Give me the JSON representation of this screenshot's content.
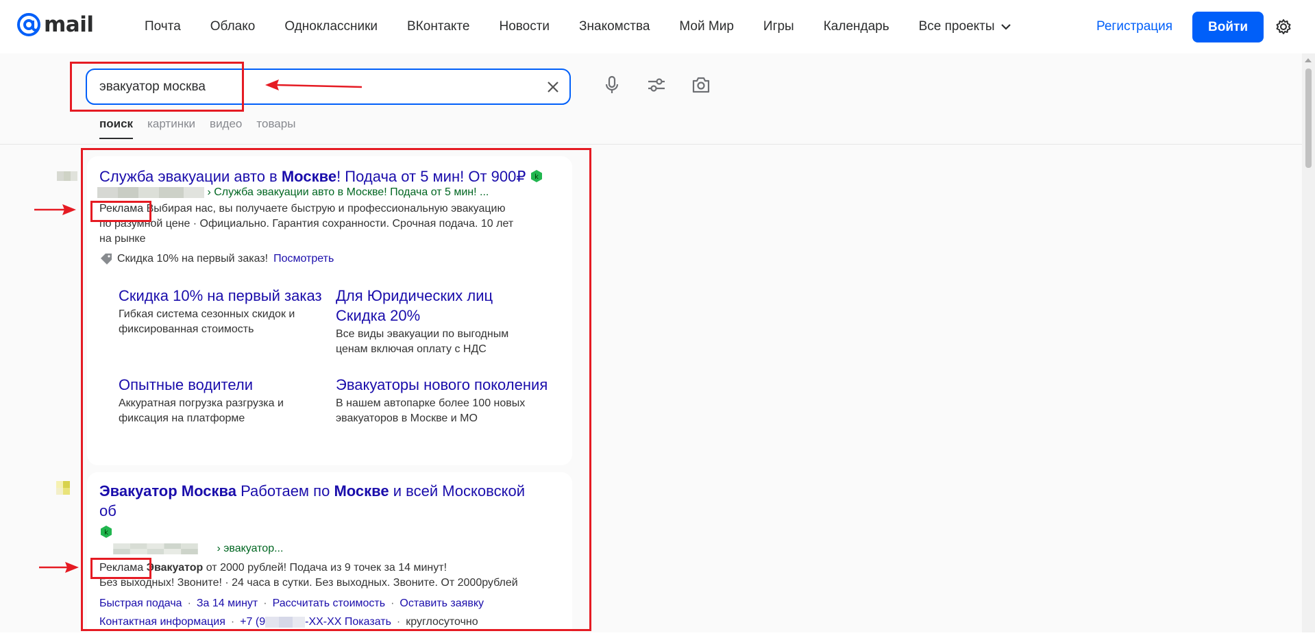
{
  "header": {
    "logo_text": "mail",
    "nav": [
      "Почта",
      "Облако",
      "Одноклассники",
      "ВКонтакте",
      "Новости",
      "Знакомства",
      "Мой Мир",
      "Игры",
      "Календарь"
    ],
    "all_projects": "Все проекты",
    "register": "Регистрация",
    "login": "Войти"
  },
  "search": {
    "query": "эвакуатор москва",
    "tabs": [
      "поиск",
      "картинки",
      "видео",
      "товары"
    ],
    "active_tab": "поиск"
  },
  "results": [
    {
      "title_parts": [
        "Служба эвакуации авто в ",
        "Москве",
        "! Подача от 5 мин! От 900₽"
      ],
      "url_text": "› Служба эвакуации авто в Москве! Подача от 5 мин! ...",
      "ad_label": "Реклама",
      "snippet_line1": " Выбирая нас, вы получаете быструю и профессиональную эвакуацию",
      "snippet_line2": "по разумной цене · Официально. Гарантия сохранности. Срочная подача. 10 лет",
      "snippet_line3": "на рынке",
      "promo_text": "Скидка 10% на первый заказ!",
      "promo_link": "Посмотреть",
      "sitelinks": [
        {
          "title": "Скидка 10% на первый заказ",
          "text": "Гибкая система сезонных скидок и фиксированная стоимость"
        },
        {
          "title": "Для Юридических лиц Скидка 20%",
          "text": "Все виды эвакуации по выгодным ценам включая оплату с НДС"
        },
        {
          "title": "Опытные водители",
          "text": "Аккуратная погрузка разгрузка и фиксация на платформе"
        },
        {
          "title": "Эвакуаторы нового поколения",
          "text": "В нашем автопарке более 100 новых эвакуаторов в Москве и МО"
        }
      ]
    },
    {
      "title_parts": [
        "Эвакуатор Москва",
        " Работаем по ",
        "Москве",
        " и всей Московской об"
      ],
      "url_text": "› эвакуатор...",
      "ad_label": "Реклама",
      "snippet_bold": "Эвакуатор",
      "snippet_line1": " от 2000 рублей! Подача из 9 точек за 14 минут!",
      "snippet_line2": "Без выходных! Звоните! · 24 часа в сутки. Без выходных. Звоните. От 2000рублей",
      "quick_links_1": [
        "Быстрая подача",
        "За 14 минут",
        "Рассчитать стоимость",
        "Оставить заявку"
      ],
      "quick_links_2_a": "Контактная информация",
      "phone_prefix": "+7 (9",
      "phone_suffix": "-XX-XX",
      "phone_show": "Показать",
      "hours": "круглосуточно"
    }
  ],
  "colors": {
    "accent": "#005ff9",
    "link": "#1a0dab",
    "url_green": "#006621",
    "annotation_red": "#e51b23"
  }
}
